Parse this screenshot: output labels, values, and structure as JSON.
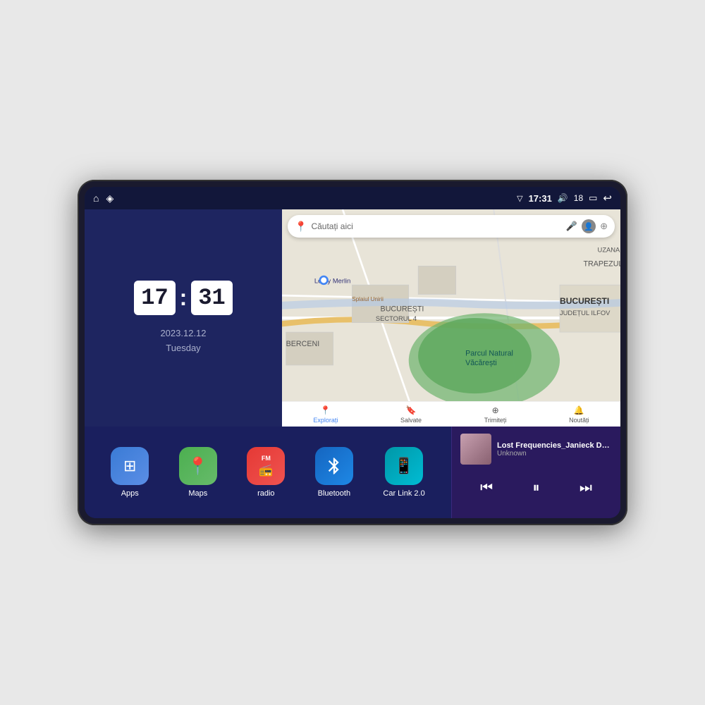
{
  "device": {
    "border_color": "#1a1a2e"
  },
  "status_bar": {
    "left_icons": [
      "⌂",
      "◈"
    ],
    "time": "17:31",
    "volume_icon": "🔊",
    "battery_level": "18",
    "battery_icon": "▭",
    "back_icon": "↩"
  },
  "clock": {
    "hour": "17",
    "minute": "31",
    "date": "2023.12.12",
    "day": "Tuesday"
  },
  "map": {
    "search_placeholder": "Căutați aici",
    "location_name": "Parcul Natural Văcărești",
    "city": "BUCUREȘTI",
    "county": "JUDEȚUL ILFOV",
    "district": "BERCENI",
    "district2": "BUCUREȘTI SECTORUL 4",
    "store": "Leroy Merlin",
    "road": "Splaiul Unirii",
    "area": "TRAPEZULUI",
    "area2": "UZANA",
    "nav_items": [
      {
        "label": "Explorați",
        "icon": "📍",
        "active": true
      },
      {
        "label": "Salvate",
        "icon": "🔖",
        "active": false
      },
      {
        "label": "Trimiteți",
        "icon": "⊕",
        "active": false
      },
      {
        "label": "Noutăți",
        "icon": "🔔",
        "active": false
      }
    ]
  },
  "apps": [
    {
      "label": "Apps",
      "icon_class": "icon-apps",
      "icon": "⊞"
    },
    {
      "label": "Maps",
      "icon_class": "icon-maps",
      "icon": "📍"
    },
    {
      "label": "radio",
      "icon_class": "icon-radio",
      "icon": "📻"
    },
    {
      "label": "Bluetooth",
      "icon_class": "icon-bluetooth",
      "icon": "🔷"
    },
    {
      "label": "Car Link 2.0",
      "icon_class": "icon-carlink",
      "icon": "🚗"
    }
  ],
  "music": {
    "title": "Lost Frequencies_Janieck Devy-...",
    "artist": "Unknown",
    "prev_icon": "⏮",
    "play_icon": "⏸",
    "next_icon": "⏭"
  }
}
